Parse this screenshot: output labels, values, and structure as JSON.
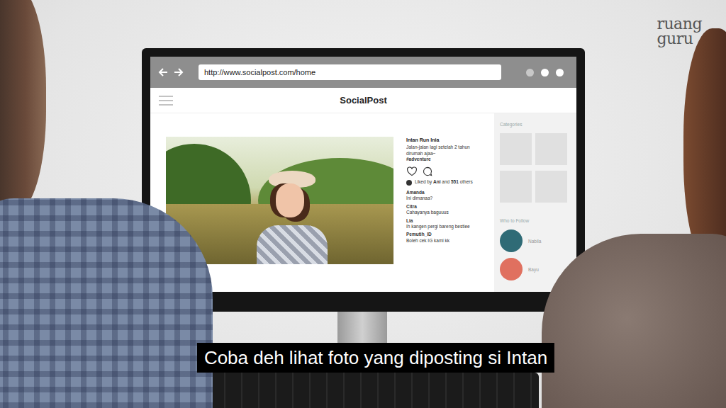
{
  "logo": {
    "line1": "ruang",
    "line2": "guru"
  },
  "browser": {
    "url": "http://www.socialpost.com/home"
  },
  "site": {
    "title": "SocialPost"
  },
  "post": {
    "author": "Intan Run Inia",
    "caption": "Jalan-jalan lagi setelah 2 tahun dirumah ajaa~",
    "hashtag": "#adventure",
    "liked": false,
    "likes": {
      "prefix": "Liked by",
      "user": "Ani",
      "middle": "and",
      "count": "551",
      "suffix": "others"
    },
    "comments": [
      {
        "user": "Amanda",
        "text": "Ini dimanaa?"
      },
      {
        "user": "Citra",
        "text": "Cahayanya baguuus"
      },
      {
        "user": "Lia",
        "text": "Ih kangen pergi bareng bestiee"
      },
      {
        "user": "Pemutih_ID",
        "text": "Boleh cek IG kami kk"
      }
    ]
  },
  "sidebar": {
    "categories_title": "Categories",
    "follow_title": "Who to Follow",
    "follow": [
      {
        "name": "Nabila",
        "color": "#2f6b76"
      },
      {
        "name": "Bayu",
        "color": "#e0705f"
      }
    ]
  },
  "subtitle": "Coba deh lihat foto yang diposting si Intan"
}
